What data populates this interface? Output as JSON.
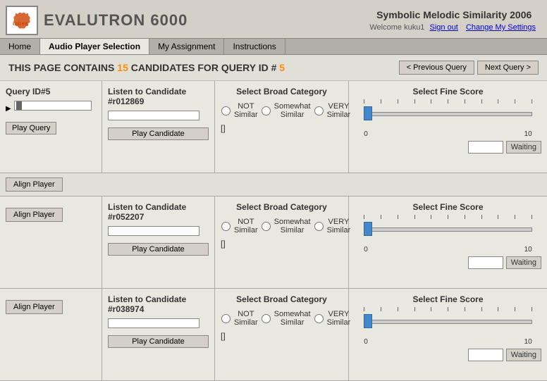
{
  "app": {
    "logo_text": "mirex",
    "app_name": "EVALUTRON 6000",
    "subtitle": "Symbolic Melodic Similarity 2006",
    "welcome_text": "Welcome kuku1",
    "sign_out_label": "Sign out",
    "settings_label": "Change My Settings"
  },
  "nav": {
    "items": [
      "Home",
      "Audio Player Selection",
      "My Assignment",
      "Instructions"
    ],
    "active": "Audio Player Selection"
  },
  "page": {
    "title_prefix": "THIS PAGE CONTAINS",
    "count": "15",
    "title_mid": "CANDIDATES FOR QUERY ID #",
    "query_id": "5",
    "prev_btn": "< Previous Query",
    "next_btn": "Next Query >"
  },
  "query": {
    "id_label": "Query ID#5",
    "play_label": "Play Query"
  },
  "candidates": [
    {
      "id": "#r012869",
      "listen_label": "Listen to Candidate",
      "play_label": "Play Candidate",
      "broad_title": "Select Broad Category",
      "not_similar": "NOT Similar",
      "somewhat_similar": "Somewhat Similar",
      "very_similar": "VERY Similar",
      "bracket": "[]",
      "fine_title": "Select Fine Score",
      "scale_min": "0",
      "scale_max": "10",
      "waiting_label": "Waiting",
      "align_label": "Align Player"
    },
    {
      "id": "#r052207",
      "listen_label": "Listen to Candidate",
      "play_label": "Play Candidate",
      "broad_title": "Select Broad Category",
      "not_similar": "NOT Similar",
      "somewhat_similar": "Somewhat Similar",
      "very_similar": "VERY Similar",
      "bracket": "[]",
      "fine_title": "Select Fine Score",
      "scale_min": "0",
      "scale_max": "10",
      "waiting_label": "Waiting",
      "align_label": "Align Player"
    },
    {
      "id": "#r038974",
      "listen_label": "Listen to Candidate",
      "play_label": "Play Candidate",
      "broad_title": "Select Broad Category",
      "not_similar": "NOT Similar",
      "somewhat_similar": "Somewhat Similar",
      "very_similar": "VERY Similar",
      "bracket": "[]",
      "fine_title": "Select Fine Score",
      "scale_min": "0",
      "scale_max": "10",
      "waiting_label": "Waiting",
      "align_label": "Align Player"
    }
  ]
}
